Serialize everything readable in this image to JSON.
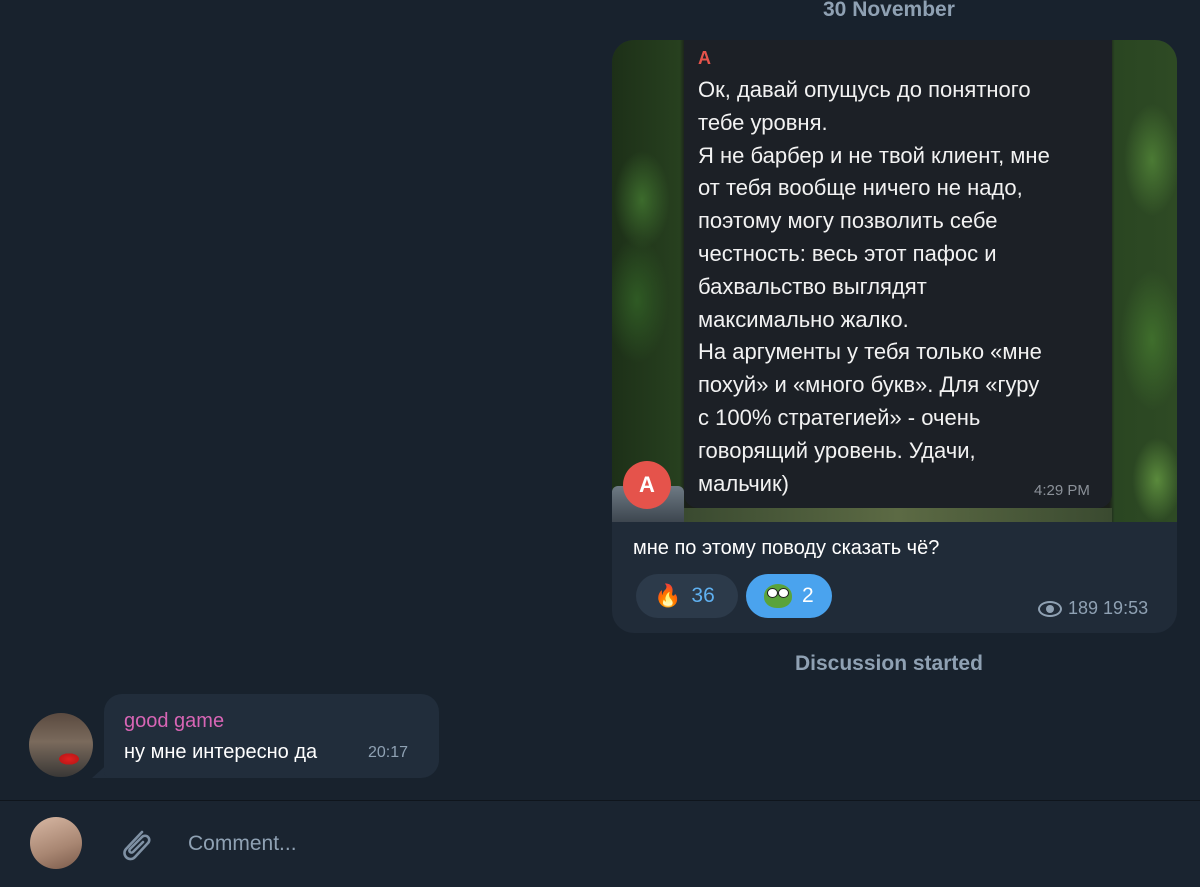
{
  "date_label": "30 November",
  "post": {
    "quote": {
      "author": "A",
      "avatar_letter": "A",
      "text": "Ок, давай опущусь до понятного\nтебе уровня.\nЯ не барбер и не твой клиент, мне\nот тебя вообще ничего не надо,\nпоэтому могу позволить себе\nчестность: весь этот пафос и\nбахвальство выглядят\nмаксимально жалко.\nНа аргументы у тебя только «мне\nпохуй» и «много букв». Для «гуру\nс 100% стратегией» - очень\nговорящий уровень. Удачи,\nмальчик)",
      "time": "4:29 PM",
      "author_color": "#e5534b"
    },
    "caption": "мне по этому поводу сказать чё?",
    "reactions": [
      {
        "icon": "fire-emoji",
        "emoji": "🔥",
        "count": "36"
      },
      {
        "icon": "pepe-emoji",
        "count": "2"
      }
    ],
    "views": "189",
    "time": "19:53"
  },
  "service_message": "Discussion started",
  "comment": {
    "author": "good game",
    "author_color": "#d765b5",
    "text": "ну мне интересно да",
    "time": "20:17"
  },
  "input": {
    "placeholder": "Comment..."
  }
}
